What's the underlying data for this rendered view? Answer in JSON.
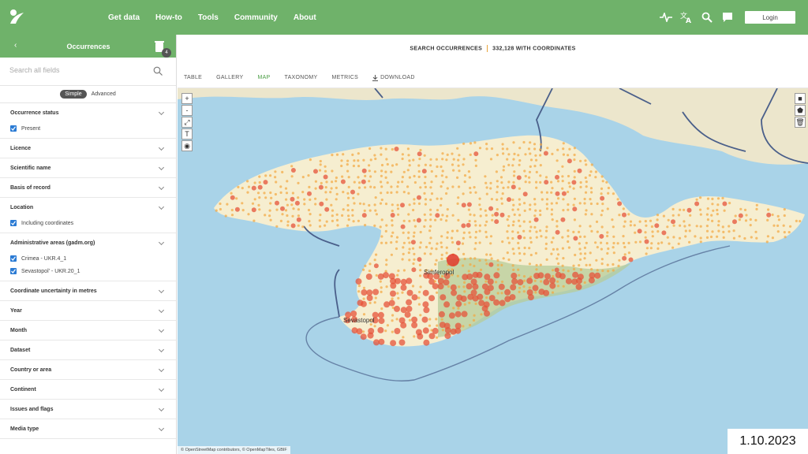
{
  "nav": {
    "links": [
      "Get data",
      "How-to",
      "Tools",
      "Community",
      "About"
    ],
    "login_label": "Login",
    "icons": [
      "activity-icon",
      "translate-icon",
      "search-icon",
      "feedback-icon"
    ]
  },
  "sidebar": {
    "back_label": "‹",
    "title": "Occurrences",
    "badge_count": "4",
    "search_placeholder": "Search all fields",
    "mode_simple": "Simple",
    "mode_advanced": "Advanced",
    "filters": [
      {
        "label": "Occurrence status",
        "options": [
          "Present"
        ]
      },
      {
        "label": "Licence",
        "options": []
      },
      {
        "label": "Scientific name",
        "options": []
      },
      {
        "label": "Basis of record",
        "options": []
      },
      {
        "label": "Location",
        "options": [
          "Including coordinates"
        ]
      },
      {
        "label": "Administrative areas (gadm.org)",
        "options": [
          "Crimea - UKR.4_1",
          "Sevastopol' - UKR.20_1"
        ]
      },
      {
        "label": "Coordinate uncertainty in metres",
        "options": []
      },
      {
        "label": "Year",
        "options": []
      },
      {
        "label": "Month",
        "options": []
      },
      {
        "label": "Dataset",
        "options": []
      },
      {
        "label": "Country or area",
        "options": []
      },
      {
        "label": "Continent",
        "options": []
      },
      {
        "label": "Issues and flags",
        "options": []
      },
      {
        "label": "Media type",
        "options": []
      }
    ]
  },
  "main": {
    "heading_left": "SEARCH OCCURRENCES",
    "heading_right": "332,128 WITH COORDINATES",
    "tabs": [
      "TABLE",
      "GALLERY",
      "MAP",
      "TAXONOMY",
      "METRICS",
      "DOWNLOAD"
    ],
    "active_tab": "MAP"
  },
  "map": {
    "labels": {
      "simferopol": "Simferopol",
      "sevastopol": "Sevastopol"
    },
    "zoom_in": "+",
    "zoom_out": "-",
    "attribution": "© OpenStreetMap contributors, © OpenMapTiles, GBIF",
    "colors": {
      "sea": "#a9d3e8",
      "land": "#f6eed0",
      "dot_light": "#f4a73e",
      "dot_dark": "#e5533a",
      "border": "#4a5f8a"
    }
  },
  "date_stamp": "1.10.2023"
}
